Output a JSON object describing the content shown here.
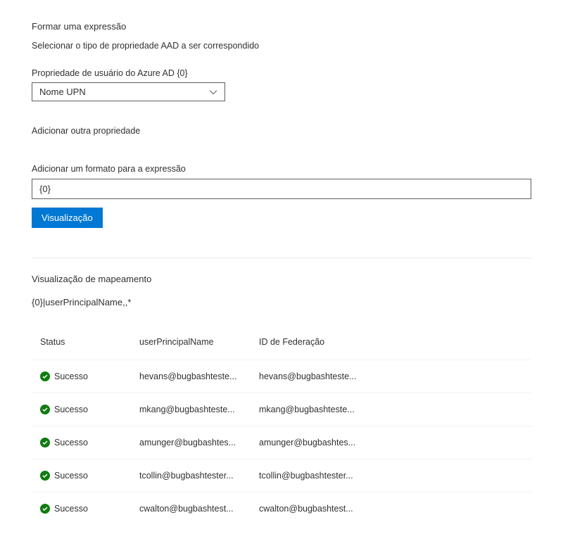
{
  "header": {
    "title": "Formar uma expressão",
    "subtitle": "Selecionar o tipo de propriedade AAD a ser correspondido"
  },
  "propertyField": {
    "label": "Propriedade de usuário do Azure AD {0}",
    "value": "Nome UPN"
  },
  "addProperty": {
    "label": "Adicionar outra propriedade"
  },
  "formatSection": {
    "label": "Adicionar um formato para a expressão",
    "value": "{0}"
  },
  "previewButton": {
    "label": "Visualização"
  },
  "previewSection": {
    "title": "Visualização de mapeamento",
    "expression": "{0}|userPrincipalName,,*"
  },
  "table": {
    "headers": {
      "status": "Status",
      "upn": "userPrincipalName",
      "fedId": "ID de Federação"
    },
    "rows": [
      {
        "status": "Sucesso",
        "upn": "hevans@bugbashteste...",
        "fedId": "hevans@bugbashteste..."
      },
      {
        "status": "Sucesso",
        "upn": "mkang@bugbashteste...",
        "fedId": "mkang@bugbashteste..."
      },
      {
        "status": "Sucesso",
        "upn": "amunger@bugbashtes...",
        "fedId": "amunger@bugbashtes..."
      },
      {
        "status": "Sucesso",
        "upn": "tcollin@bugbashtester...",
        "fedId": "tcollin@bugbashtester..."
      },
      {
        "status": "Sucesso",
        "upn": "cwalton@bugbashtest...",
        "fedId": "cwalton@bugbashtest..."
      }
    ]
  },
  "colors": {
    "success": "#107c10",
    "primary": "#0078d4"
  }
}
